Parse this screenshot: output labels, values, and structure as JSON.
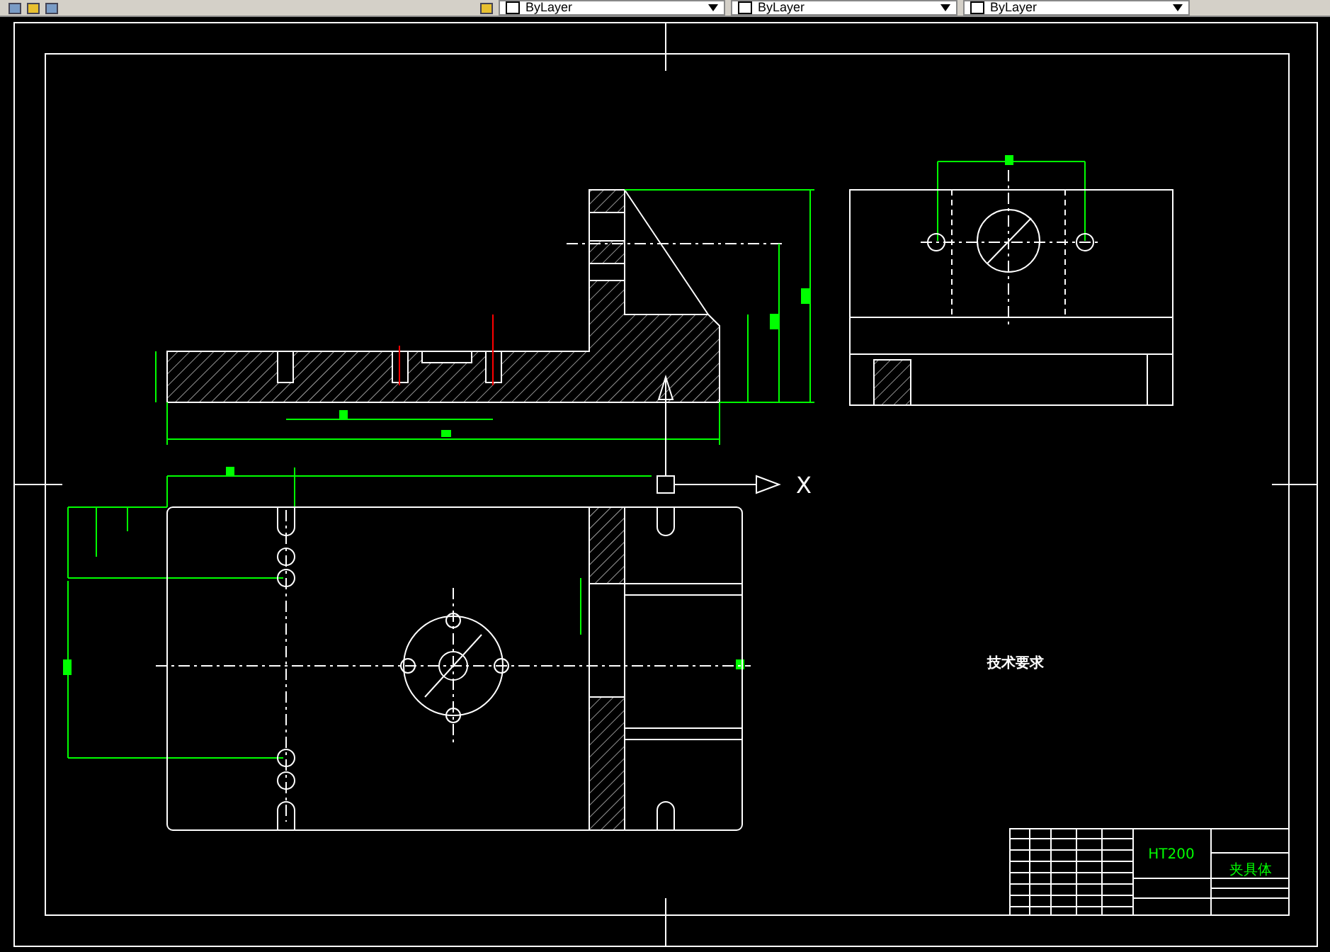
{
  "toolbar": {
    "dropdowns": [
      {
        "value": "ByLayer"
      },
      {
        "value": "ByLayer"
      },
      {
        "value": "ByLayer"
      }
    ]
  },
  "drawing": {
    "axis_label": "X",
    "notes_title": "技术要求",
    "title_block": {
      "material": "HT200",
      "part_name": "夹具体"
    }
  }
}
